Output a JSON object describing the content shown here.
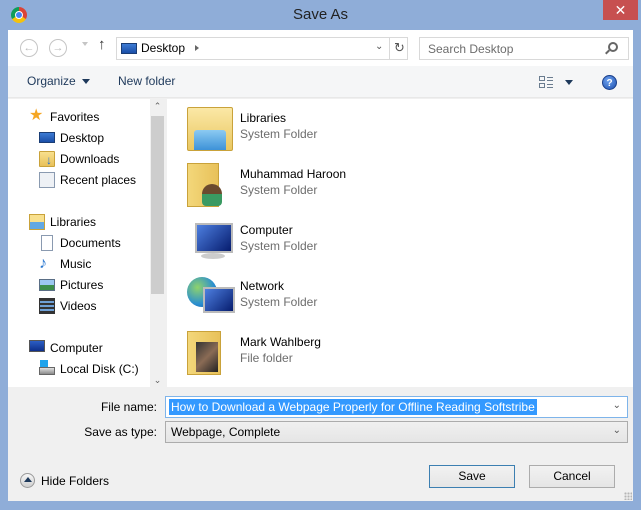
{
  "window": {
    "title": "Save As",
    "close_glyph": "✕"
  },
  "navigation": {
    "back_glyph": "←",
    "forward_glyph": "→",
    "up_glyph": "↑",
    "address_location": "Desktop",
    "address_dropdown_glyph": "⌄",
    "refresh_glyph": "↻",
    "search_placeholder": "Search Desktop"
  },
  "toolbar": {
    "organize_label": "Organize",
    "new_folder_label": "New folder",
    "help_glyph": "?"
  },
  "sidebar": {
    "groups": [
      {
        "label": "Favorites",
        "icon": "star-icon",
        "items": [
          {
            "label": "Desktop",
            "icon": "desktop-icon"
          },
          {
            "label": "Downloads",
            "icon": "downloads-icon"
          },
          {
            "label": "Recent places",
            "icon": "recent-places-icon"
          }
        ]
      },
      {
        "label": "Libraries",
        "icon": "libraries-icon",
        "items": [
          {
            "label": "Documents",
            "icon": "documents-icon"
          },
          {
            "label": "Music",
            "icon": "music-icon"
          },
          {
            "label": "Pictures",
            "icon": "pictures-icon"
          },
          {
            "label": "Videos",
            "icon": "videos-icon"
          }
        ]
      },
      {
        "label": "Computer",
        "icon": "computer-icon",
        "items": [
          {
            "label": "Local Disk (C:)",
            "icon": "local-disk-icon"
          }
        ]
      }
    ],
    "scroll_up_glyph": "⌃",
    "scroll_down_glyph": "⌄"
  },
  "content": {
    "items": [
      {
        "name": "Libraries",
        "type": "System Folder",
        "icon": "libraries-folder-icon"
      },
      {
        "name": "Muhammad Haroon",
        "type": "System Folder",
        "icon": "user-folder-icon"
      },
      {
        "name": "Computer",
        "type": "System Folder",
        "icon": "computer-icon"
      },
      {
        "name": "Network",
        "type": "System Folder",
        "icon": "network-icon"
      },
      {
        "name": "Mark Wahlberg",
        "type": "File folder",
        "icon": "photo-folder-icon"
      }
    ]
  },
  "form": {
    "file_name_label": "File name:",
    "file_name_value": "How to Download a Webpage Properly for Offline Reading   Softstribe",
    "save_type_label": "Save as type:",
    "save_type_value": "Webpage, Complete",
    "dropdown_glyph": "⌄"
  },
  "footer": {
    "hide_folders_label": "Hide Folders",
    "save_label": "Save",
    "cancel_label": "Cancel"
  }
}
